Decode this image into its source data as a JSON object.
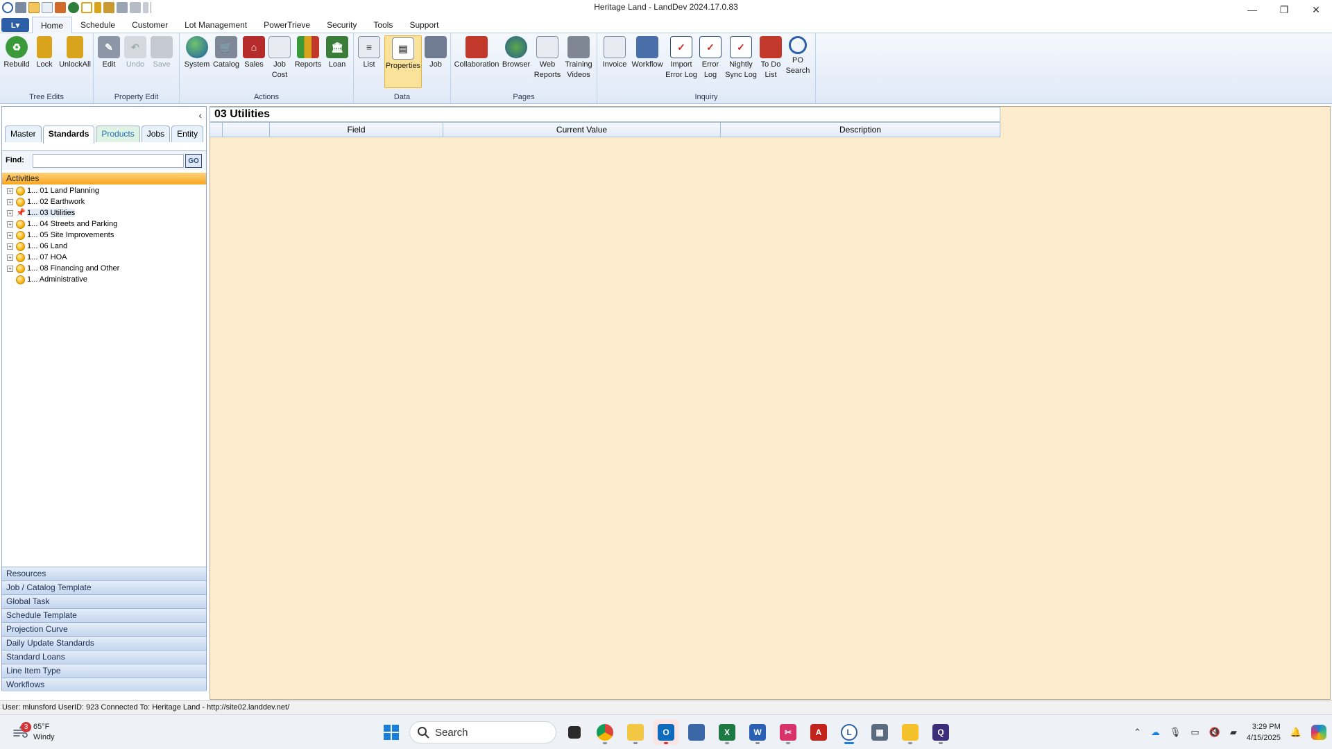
{
  "window": {
    "title": "Heritage Land - LandDev 2024.17.0.83",
    "minimize": "—",
    "restore": "❐",
    "close": "✕"
  },
  "menu": {
    "app_button": "L▾",
    "tabs": [
      "Home",
      "Schedule",
      "Customer",
      "Lot Management",
      "PowerTrieve",
      "Security",
      "Tools",
      "Support"
    ]
  },
  "ribbon": {
    "groups": {
      "tree_edits": "Tree Edits",
      "property_edit": "Property Edit",
      "actions": "Actions",
      "data": "Data",
      "pages": "Pages",
      "inquiry": "Inquiry"
    },
    "buttons": {
      "rebuild": "Rebuild",
      "lock": "Lock",
      "unlock_all": "UnlockAll",
      "edit": "Edit",
      "undo": "Undo",
      "save": "Save",
      "system": "System",
      "catalog": "Catalog",
      "sales": "Sales",
      "job_cost_1": "Job",
      "job_cost_2": "Cost",
      "reports": "Reports",
      "loan": "Loan",
      "list": "List",
      "properties": "Properties",
      "job": "Job",
      "collaboration": "Collaboration",
      "browser": "Browser",
      "web_reports_1": "Web",
      "web_reports_2": "Reports",
      "training_1": "Training",
      "training_2": "Videos",
      "invoice": "Invoice",
      "workflow": "Workflow",
      "import_1": "Import",
      "import_2": "Error Log",
      "error_1": "Error",
      "error_2": "Log",
      "nightly_1": "Nightly",
      "nightly_2": "Sync Log",
      "todo_1": "To Do",
      "todo_2": "List",
      "po_1": "PO",
      "po_2": "Search"
    }
  },
  "left": {
    "collapse": "‹",
    "tabs": {
      "master": "Master",
      "standards": "Standards",
      "products": "Products",
      "jobs": "Jobs",
      "entity": "Entity"
    },
    "find_label": "Find:",
    "find_value": "",
    "go": "GO",
    "activities_header": "Activities",
    "tree": [
      "1... 01 Land Planning",
      "1... 02 Earthwork",
      "1... 03 Utilities",
      "1... 04 Streets and Parking",
      "1... 05 Site Improvements",
      "1... 06 Land",
      "1... 07 HOA",
      "1... 08 Financing and Other",
      "1... Administrative"
    ],
    "bars": [
      "Resources",
      "Job / Catalog Template",
      "Global Task",
      "Schedule Template",
      "Projection Curve",
      "Daily Update Standards",
      "Standard Loans",
      "Line Item Type",
      "Workflows"
    ]
  },
  "grid": {
    "title": "03 Utilities",
    "col_field": "Field",
    "col_value": "Current Value",
    "col_desc": "Description"
  },
  "status": {
    "text": "User: mlunsford   UserID: 923   Connected To: Heritage Land  -  http://site02.landdev.net/"
  },
  "taskbar": {
    "weather_badge": "3",
    "temp": "65°F",
    "condition": "Windy",
    "search": "Search",
    "time": "3:29 PM",
    "date": "4/15/2025"
  }
}
